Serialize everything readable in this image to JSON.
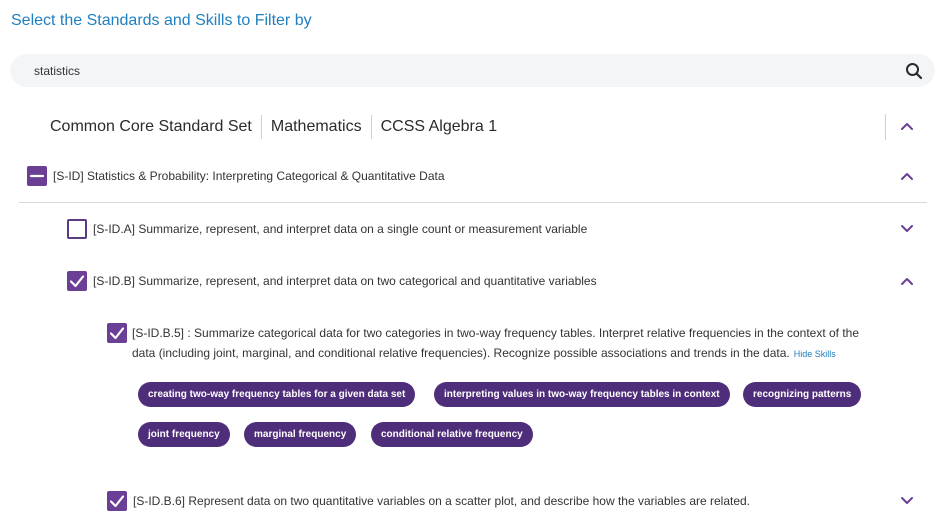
{
  "page": {
    "title": "Select the Standards and Skills to Filter by"
  },
  "search": {
    "value": "statistics",
    "icon": "search-icon"
  },
  "breadcrumb": {
    "items": [
      "Common Core Standard Set",
      "Mathematics",
      "CCSS Algebra 1"
    ]
  },
  "domain": {
    "label": "[S-ID] Statistics & Probability: Interpreting Categorical & Quantitative Data",
    "state": "partial",
    "expanded": true
  },
  "clusters": [
    {
      "label": "[S-ID.A] Summarize, represent, and interpret data on a single count or measurement variable",
      "checked": false,
      "expanded": false
    },
    {
      "label": "[S-ID.B] Summarize, represent, and interpret data on two categorical and quantitative variables",
      "checked": true,
      "expanded": true
    }
  ],
  "standards": [
    {
      "code": "[S-ID.B.5]",
      "line1": "[S-ID.B.5] : Summarize categorical data for two categories in two-way frequency tables. Interpret relative frequencies in the context of the",
      "line2": "data (including joint, marginal, and conditional relative frequencies). Recognize possible associations and trends in the data.",
      "hide_skills_label": "Hide Skills",
      "checked": true,
      "skills": [
        "creating two-way frequency tables for a given data set",
        "interpreting values in two-way frequency tables in context",
        "recognizing patterns",
        "joint frequency",
        "marginal frequency",
        "conditional relative frequency"
      ]
    },
    {
      "label": "[S-ID.B.6] Represent data on two quantitative variables on a scatter plot, and describe how the variables are related.",
      "checked": true,
      "expanded": false
    }
  ],
  "colors": {
    "accent": "#6a3f95",
    "chip": "#4e2e7a",
    "title": "#1f7fc0",
    "search_bg": "#f4f5f7"
  }
}
